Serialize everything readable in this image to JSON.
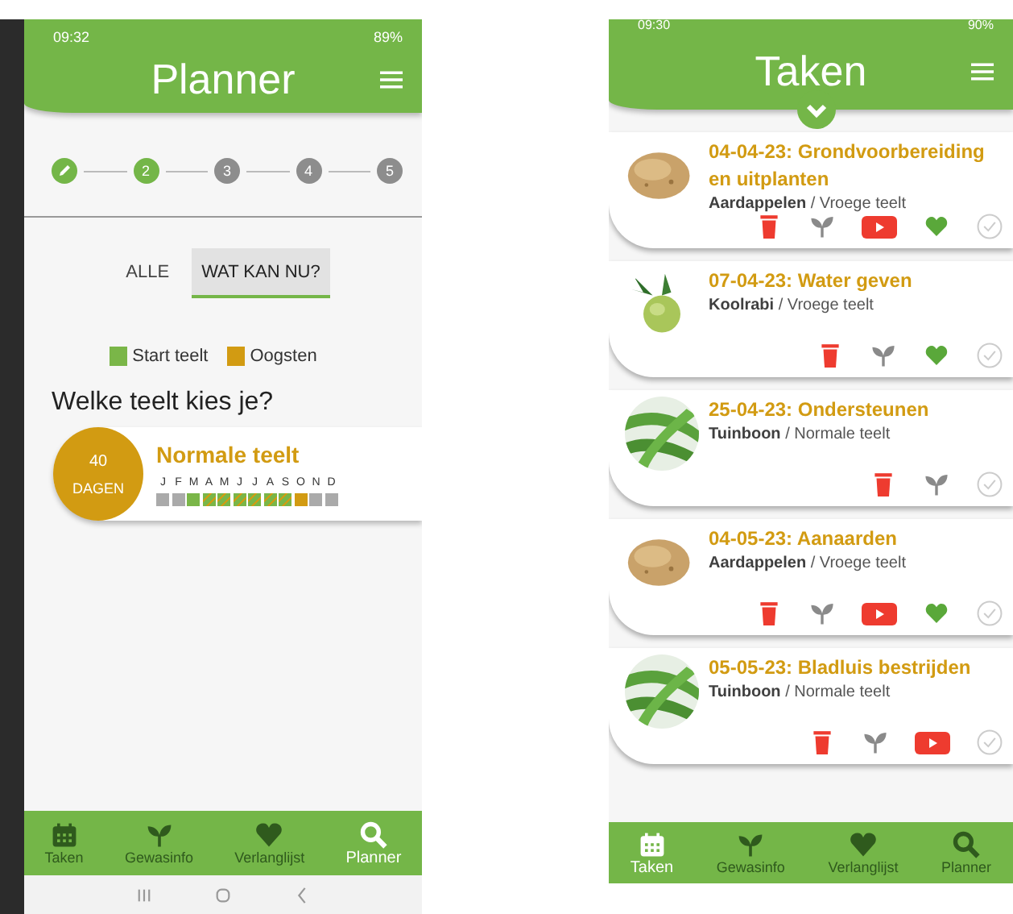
{
  "left_phone": {
    "status_bar": {
      "time": "09:32",
      "battery": "89%"
    },
    "title": "Planner",
    "steps": [
      {
        "kind": "done"
      },
      {
        "kind": "active",
        "label": "2"
      },
      {
        "kind": "todo",
        "label": "3"
      },
      {
        "kind": "todo",
        "label": "4"
      },
      {
        "kind": "todo",
        "label": "5"
      }
    ],
    "tabs": [
      {
        "label": "ALLE",
        "selected": false
      },
      {
        "label": "WAT KAN NU?",
        "selected": true
      }
    ],
    "legend": [
      {
        "label": "Start teelt",
        "color": "#7ab648"
      },
      {
        "label": "Oogsten",
        "color": "#d29b12"
      }
    ],
    "heading": "Welke teelt kies je?",
    "option": {
      "days": "40",
      "days_unit": "DAGEN",
      "name": "Normale teelt",
      "months": [
        {
          "letter": "J",
          "kind": "none"
        },
        {
          "letter": "F",
          "kind": "none"
        },
        {
          "letter": "M",
          "kind": "start"
        },
        {
          "letter": "A",
          "kind": "both"
        },
        {
          "letter": "M",
          "kind": "both"
        },
        {
          "letter": "J",
          "kind": "both"
        },
        {
          "letter": "J",
          "kind": "both"
        },
        {
          "letter": "A",
          "kind": "both"
        },
        {
          "letter": "S",
          "kind": "both"
        },
        {
          "letter": "O",
          "kind": "harvest"
        },
        {
          "letter": "N",
          "kind": "none"
        },
        {
          "letter": "D",
          "kind": "none"
        }
      ]
    },
    "nav": [
      {
        "label": "Taken",
        "kind": "calendar",
        "selected": false
      },
      {
        "label": "Gewasinfo",
        "kind": "sprout",
        "selected": false
      },
      {
        "label": "Verlanglijst",
        "kind": "heart",
        "selected": false
      },
      {
        "label": "Planner",
        "kind": "search",
        "selected": true
      }
    ]
  },
  "right_phone": {
    "status_bar": {
      "time": "09:30",
      "battery": "90%"
    },
    "title": "Taken",
    "tasks": [
      {
        "title": "04-04-23: Grondvoorbereiding en uitplanten",
        "subtitle": "**Aardappelen** / Vroege teelt",
        "picture": {
          "kind": "potato"
        },
        "actions": [
          {
            "kind": "trash"
          },
          {
            "kind": "sprout"
          },
          {
            "kind": "video"
          },
          {
            "kind": "heart"
          },
          {
            "kind": "check"
          }
        ]
      },
      {
        "title": "07-04-23: Water geven",
        "subtitle": "**Koolrabi** / Vroege teelt",
        "picture": {
          "kind": "kohlrabi"
        },
        "actions": [
          {
            "kind": "trash"
          },
          {
            "kind": "sprout"
          },
          {
            "kind": "heart"
          },
          {
            "kind": "check"
          }
        ]
      },
      {
        "title": "25-04-23: Ondersteunen",
        "subtitle": "**Tuinboon** / Normale teelt",
        "picture": {
          "kind": "beans"
        },
        "actions": [
          {
            "kind": "trash"
          },
          {
            "kind": "sprout"
          },
          {
            "kind": "check"
          }
        ]
      },
      {
        "title": "04-05-23: Aanaarden",
        "subtitle": "**Aardappelen** / Vroege teelt",
        "picture": {
          "kind": "potato"
        },
        "actions": [
          {
            "kind": "trash"
          },
          {
            "kind": "sprout"
          },
          {
            "kind": "video"
          },
          {
            "kind": "heart"
          },
          {
            "kind": "check"
          }
        ]
      },
      {
        "title": "05-05-23: Bladluis bestrijden",
        "subtitle": "**Tuinboon** / Normale teelt",
        "picture": {
          "kind": "beans"
        },
        "actions": [
          {
            "kind": "trash"
          },
          {
            "kind": "sprout"
          },
          {
            "kind": "video"
          },
          {
            "kind": "check"
          }
        ]
      }
    ],
    "nav": [
      {
        "label": "Taken",
        "kind": "calendar",
        "selected": true
      },
      {
        "label": "Gewasinfo",
        "kind": "sprout",
        "selected": false
      },
      {
        "label": "Verlanglijst",
        "kind": "heart",
        "selected": false
      },
      {
        "label": "Planner",
        "kind": "search",
        "selected": false
      }
    ]
  }
}
